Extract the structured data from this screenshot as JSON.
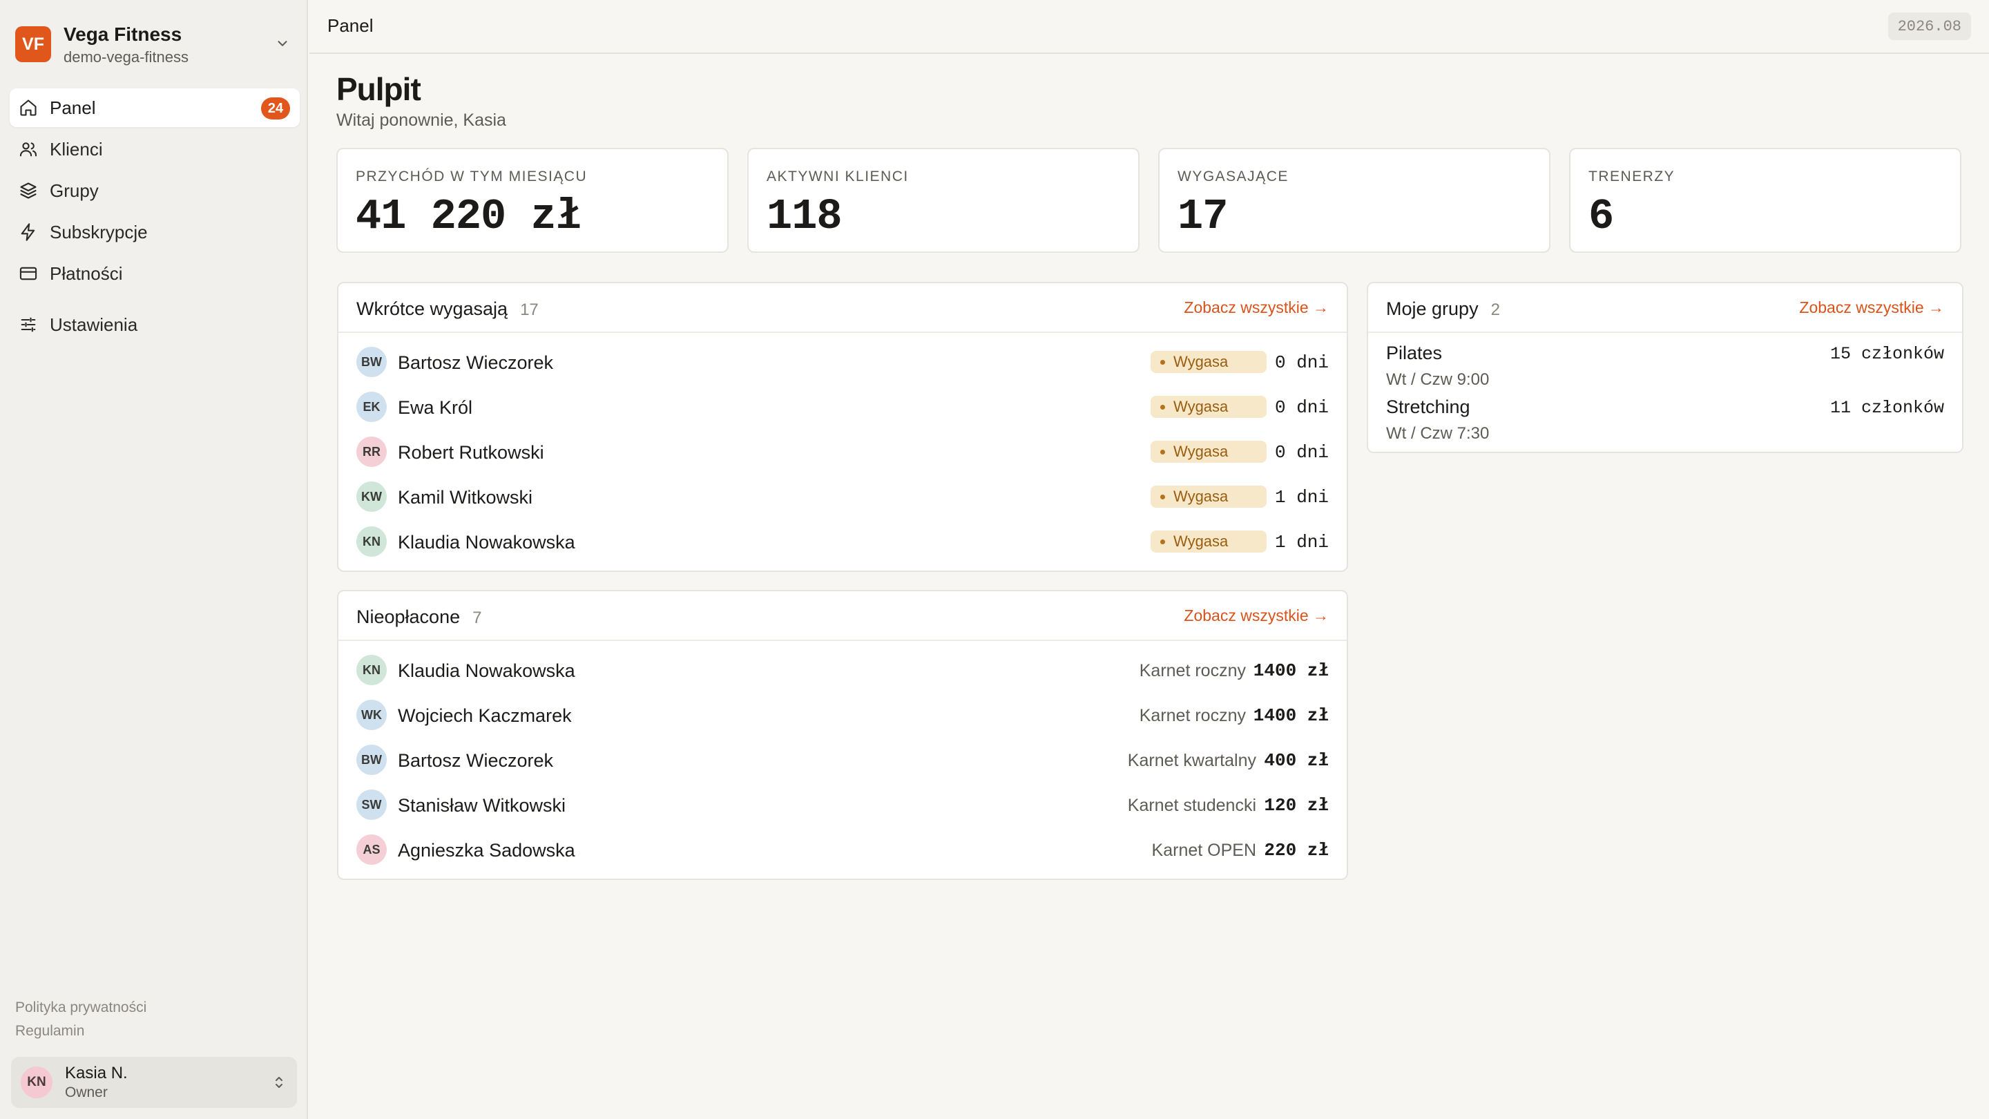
{
  "org": {
    "logo_initials": "VF",
    "name": "Vega Fitness",
    "slug": "demo-vega-fitness"
  },
  "nav": {
    "items": [
      {
        "label": "Panel",
        "icon": "home-icon",
        "badge": "24",
        "active": true
      },
      {
        "label": "Klienci",
        "icon": "users-icon"
      },
      {
        "label": "Grupy",
        "icon": "layers-icon"
      },
      {
        "label": "Subskrypcje",
        "icon": "bolt-icon"
      },
      {
        "label": "Płatności",
        "icon": "credit-card-icon"
      },
      {
        "label": "Ustawienia",
        "icon": "sliders-icon"
      }
    ]
  },
  "footer": {
    "privacy": "Polityka prywatności",
    "terms": "Regulamin"
  },
  "user": {
    "initials": "KN",
    "name": "Kasia N.",
    "role": "Owner"
  },
  "topbar": {
    "title": "Panel",
    "version": "2026.08"
  },
  "page": {
    "title": "Pulpit",
    "subtitle": "Witaj ponownie, Kasia"
  },
  "stats": [
    {
      "label": "PRZYCHÓD W TYM MIESIĄCU",
      "value": "41 220 zł"
    },
    {
      "label": "AKTYWNI KLIENCI",
      "value": "118"
    },
    {
      "label": "WYGASAJĄCE",
      "value": "17"
    },
    {
      "label": "TRENERZY",
      "value": "6"
    }
  ],
  "expiring": {
    "title": "Wkrótce wygasają",
    "count": "17",
    "link": "Zobacz wszystkie →",
    "rows": [
      {
        "initials": "BW",
        "name": "Bartosz Wieczorek",
        "status": "Wygasa",
        "days": "0 dni",
        "avatar_color": "#cfe0ef"
      },
      {
        "initials": "EK",
        "name": "Ewa Król",
        "status": "Wygasa",
        "days": "0 dni",
        "avatar_color": "#cfe0ef"
      },
      {
        "initials": "RR",
        "name": "Robert Rutkowski",
        "status": "Wygasa",
        "days": "0 dni",
        "avatar_color": "#f4d0d6"
      },
      {
        "initials": "KW",
        "name": "Kamil Witkowski",
        "status": "Wygasa",
        "days": "1 dni",
        "avatar_color": "#cfe6d8"
      },
      {
        "initials": "KN",
        "name": "Klaudia Nowakowska",
        "status": "Wygasa",
        "days": "1 dni",
        "avatar_color": "#cfe6d8"
      }
    ]
  },
  "unpaid": {
    "title": "Nieopłacone",
    "count": "7",
    "link": "Zobacz wszystkie →",
    "rows": [
      {
        "initials": "KN",
        "name": "Klaudia Nowakowska",
        "plan": "Karnet roczny",
        "amount": "1400 zł",
        "avatar_color": "#cfe6d8"
      },
      {
        "initials": "WK",
        "name": "Wojciech Kaczmarek",
        "plan": "Karnet roczny",
        "amount": "1400 zł",
        "avatar_color": "#cfe0ef"
      },
      {
        "initials": "BW",
        "name": "Bartosz Wieczorek",
        "plan": "Karnet kwartalny",
        "amount": "400 zł",
        "avatar_color": "#cfe0ef"
      },
      {
        "initials": "SW",
        "name": "Stanisław Witkowski",
        "plan": "Karnet studencki",
        "amount": "120 zł",
        "avatar_color": "#cfe0ef"
      },
      {
        "initials": "AS",
        "name": "Agnieszka Sadowska",
        "plan": "Karnet OPEN",
        "amount": "220 zł",
        "avatar_color": "#f4d0d6"
      }
    ]
  },
  "groups": {
    "title": "Moje grupy",
    "count": "2",
    "link": "Zobacz wszystkie →",
    "rows": [
      {
        "name": "Pilates",
        "schedule": "Wt / Czw 9:00",
        "members": "15 członków"
      },
      {
        "name": "Stretching",
        "schedule": "Wt / Czw 7:30",
        "members": "11 członków"
      }
    ]
  },
  "colors": {
    "accent": "#e0561b",
    "link": "#d9531b",
    "status_bg": "#f6e8c8",
    "status_text": "#9a5d10"
  }
}
